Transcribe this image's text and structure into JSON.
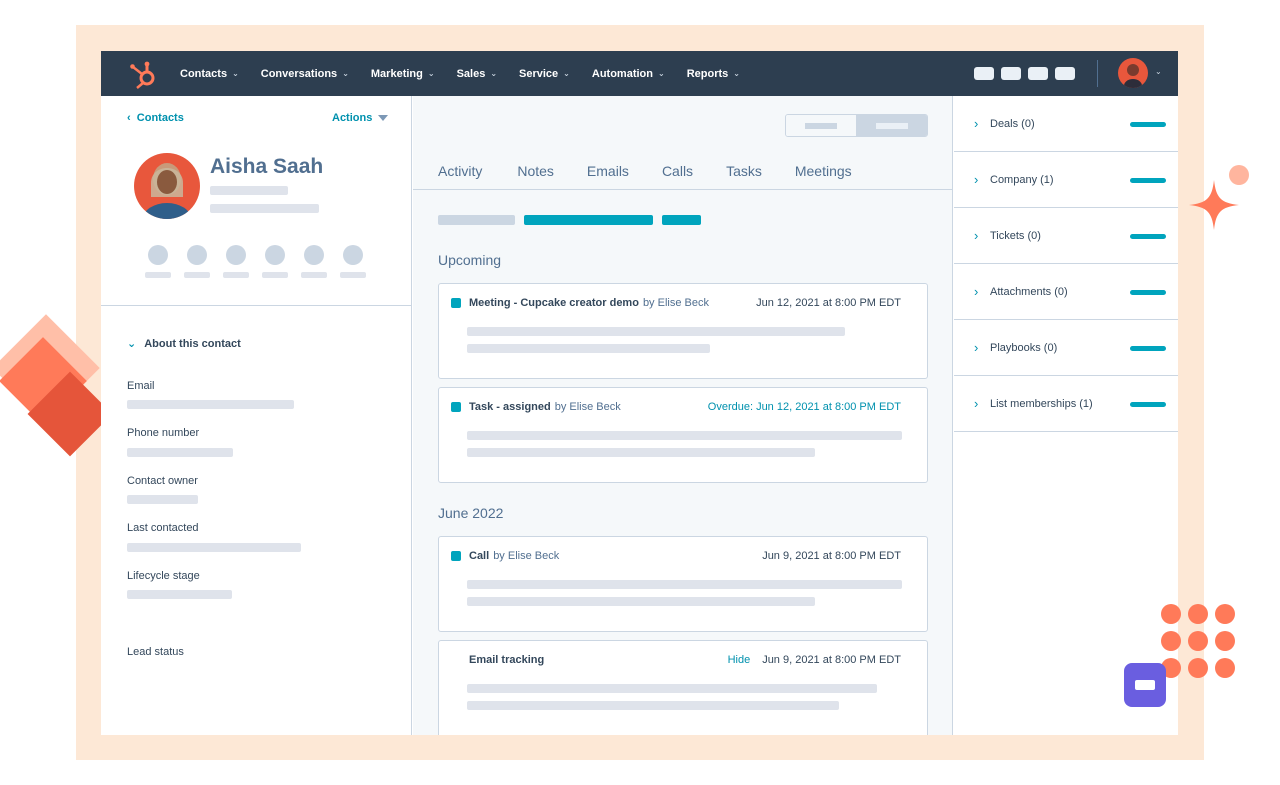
{
  "nav": {
    "items": [
      {
        "label": "Contacts"
      },
      {
        "label": "Conversations"
      },
      {
        "label": "Marketing"
      },
      {
        "label": "Sales"
      },
      {
        "label": "Service"
      },
      {
        "label": "Automation"
      },
      {
        "label": "Reports"
      }
    ]
  },
  "contact": {
    "back_label": "Contacts",
    "actions_label": "Actions",
    "name": "Aisha Saah",
    "about_label": "About this contact",
    "fields": {
      "email": "Email",
      "phone": "Phone number",
      "owner": "Contact owner",
      "last_contacted": "Last contacted",
      "lifecycle": "Lifecycle stage",
      "lead_status": "Lead status"
    }
  },
  "timeline": {
    "tabs": [
      "Activity",
      "Notes",
      "Emails",
      "Calls",
      "Tasks",
      "Meetings"
    ],
    "upcoming_title": "Upcoming",
    "june_title": "June 2022",
    "cards": [
      {
        "title": "Meeting - Cupcake creator demo",
        "by": "by Elise Beck",
        "date": "Jun 12, 2021 at 8:00 PM EDT"
      },
      {
        "title": "Task - assigned",
        "by": "by Elise Beck",
        "date": "Overdue: Jun 12, 2021 at 8:00 PM EDT"
      },
      {
        "title": "Call",
        "by": "by Elise Beck",
        "date": "Jun 9, 2021 at 8:00 PM EDT"
      },
      {
        "title": "Email tracking",
        "hide": "Hide",
        "date": "Jun 9, 2021 at 8:00 PM EDT"
      }
    ]
  },
  "sidebar": {
    "items": [
      {
        "label": "Deals (0)"
      },
      {
        "label": "Company (1)"
      },
      {
        "label": "Tickets (0)"
      },
      {
        "label": "Attachments (0)"
      },
      {
        "label": "Playbooks (0)"
      },
      {
        "label": "List memberships (1)"
      }
    ]
  },
  "colors": {
    "nav_bg": "#2d3e50",
    "accent_teal": "#00a4bd",
    "link": "#0091ae",
    "brand_orange": "#ff7a59",
    "frame": "#fde8d6"
  }
}
